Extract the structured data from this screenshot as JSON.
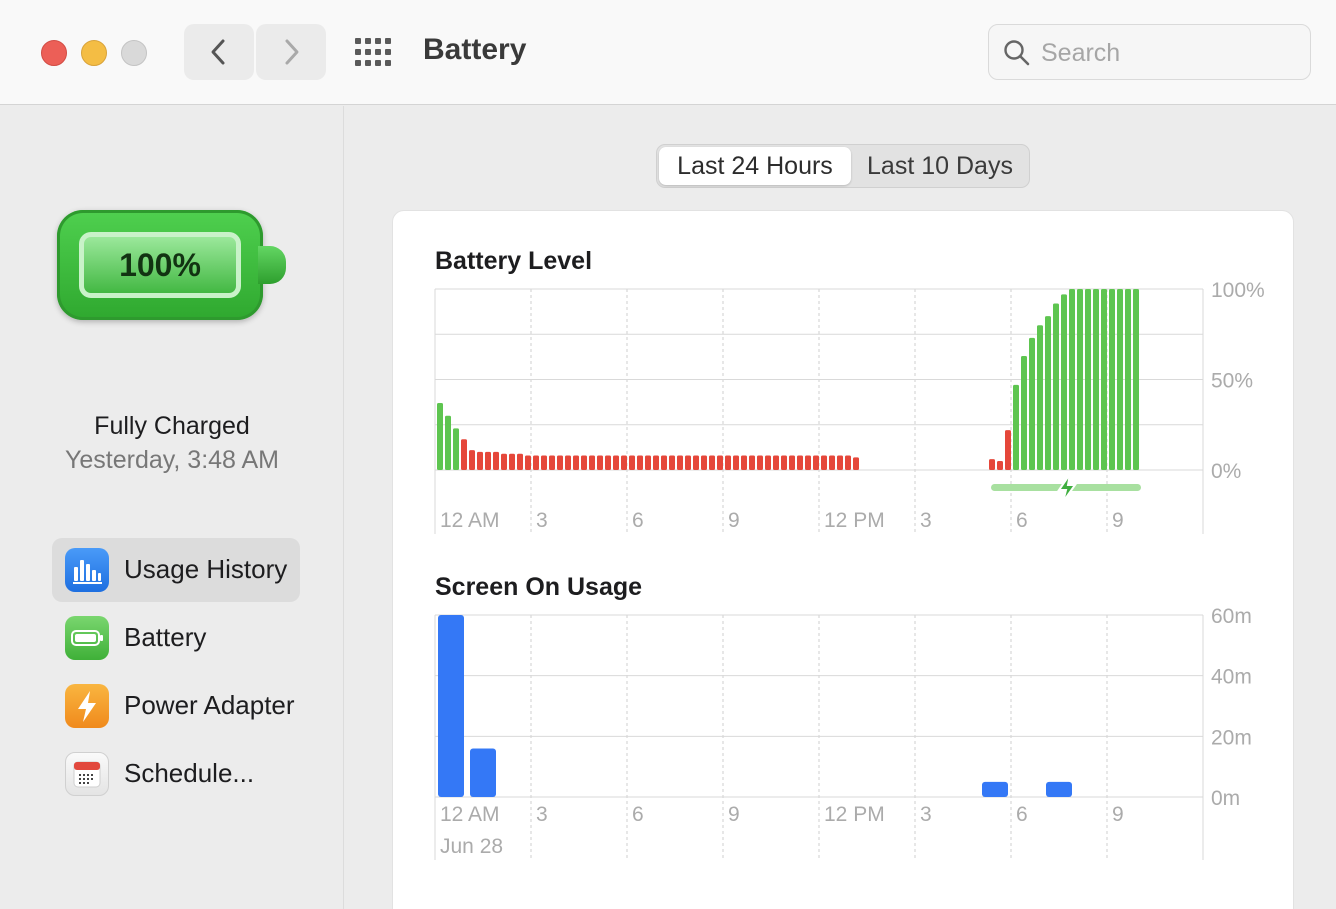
{
  "window": {
    "title": "Battery",
    "search_placeholder": "Search"
  },
  "sidebar": {
    "battery_percent": "100%",
    "status": "Fully Charged",
    "status_time": "Yesterday, 3:48 AM",
    "items": [
      {
        "label": "Usage History",
        "icon": "usage-history-icon",
        "selected": true
      },
      {
        "label": "Battery",
        "icon": "battery-icon",
        "selected": false
      },
      {
        "label": "Power Adapter",
        "icon": "power-adapter-icon",
        "selected": false
      },
      {
        "label": "Schedule...",
        "icon": "schedule-icon",
        "selected": false
      }
    ]
  },
  "segments": {
    "options": [
      "Last 24 Hours",
      "Last 10 Days"
    ],
    "selected": "Last 24 Hours"
  },
  "colors": {
    "discharging": "#e5473a",
    "charging": "#5ec550",
    "screen_on": "#3478f6",
    "charging_indicator": "#a8e0a0"
  },
  "chart_data": [
    {
      "type": "bar",
      "title": "Battery Level",
      "x_ticks": [
        "12 AM",
        "3",
        "6",
        "9",
        "12 PM",
        "3",
        "6",
        "9"
      ],
      "y_ticks": [
        "100%",
        "50%",
        "0%"
      ],
      "ylim": [
        0,
        100
      ],
      "slot_minutes": 15,
      "series": [
        {
          "state": "discharging",
          "points": [
            [
              0,
              37
            ],
            [
              1,
              30
            ],
            [
              2,
              23
            ],
            [
              3,
              17
            ],
            [
              4,
              11
            ],
            [
              5,
              10
            ],
            [
              6,
              10
            ],
            [
              7,
              10
            ],
            [
              8,
              9
            ],
            [
              9,
              9
            ],
            [
              10,
              9
            ],
            [
              11,
              8
            ],
            [
              12,
              8
            ],
            [
              13,
              8
            ],
            [
              14,
              8
            ],
            [
              15,
              8
            ],
            [
              16,
              8
            ],
            [
              17,
              8
            ],
            [
              18,
              8
            ],
            [
              19,
              8
            ],
            [
              20,
              8
            ],
            [
              21,
              8
            ],
            [
              22,
              8
            ],
            [
              23,
              8
            ],
            [
              24,
              8
            ],
            [
              25,
              8
            ],
            [
              26,
              8
            ],
            [
              27,
              8
            ],
            [
              28,
              8
            ],
            [
              29,
              8
            ],
            [
              30,
              8
            ],
            [
              31,
              8
            ],
            [
              32,
              8
            ],
            [
              33,
              8
            ],
            [
              34,
              8
            ],
            [
              35,
              8
            ],
            [
              36,
              8
            ],
            [
              37,
              8
            ],
            [
              38,
              8
            ],
            [
              39,
              8
            ],
            [
              40,
              8
            ],
            [
              41,
              8
            ],
            [
              42,
              8
            ],
            [
              43,
              8
            ],
            [
              44,
              8
            ],
            [
              45,
              8
            ],
            [
              46,
              8
            ],
            [
              47,
              8
            ],
            [
              48,
              8
            ],
            [
              49,
              8
            ],
            [
              50,
              8
            ],
            [
              51,
              8
            ],
            [
              52,
              7
            ],
            [
              69,
              6
            ],
            [
              70,
              5
            ],
            [
              71,
              22
            ]
          ]
        },
        {
          "state": "charging",
          "points": [
            [
              0,
              37
            ],
            [
              1,
              30
            ],
            [
              2,
              23
            ],
            [
              72,
              47
            ],
            [
              73,
              63
            ],
            [
              74,
              73
            ],
            [
              75,
              80
            ],
            [
              76,
              85
            ],
            [
              77,
              92
            ],
            [
              78,
              97
            ],
            [
              79,
              100
            ],
            [
              80,
              100
            ],
            [
              81,
              100
            ],
            [
              82,
              100
            ],
            [
              83,
              100
            ],
            [
              84,
              100
            ],
            [
              85,
              100
            ],
            [
              86,
              100
            ],
            [
              87,
              100
            ]
          ]
        }
      ],
      "charging_span": {
        "start_slot": 70,
        "end_slot": 87
      }
    },
    {
      "type": "bar",
      "title": "Screen On Usage",
      "x_ticks": [
        "12 AM",
        "3",
        "6",
        "9",
        "12 PM",
        "3",
        "6",
        "9"
      ],
      "x_subtitle": "Jun 28",
      "y_ticks": [
        "60m",
        "40m",
        "20m",
        "0m"
      ],
      "ylim": [
        0,
        60
      ],
      "unit": "minutes",
      "series": [
        {
          "name": "",
          "points": [
            [
              0,
              60
            ],
            [
              1,
              16
            ],
            [
              17,
              5
            ],
            [
              19,
              5
            ]
          ]
        }
      ]
    }
  ]
}
